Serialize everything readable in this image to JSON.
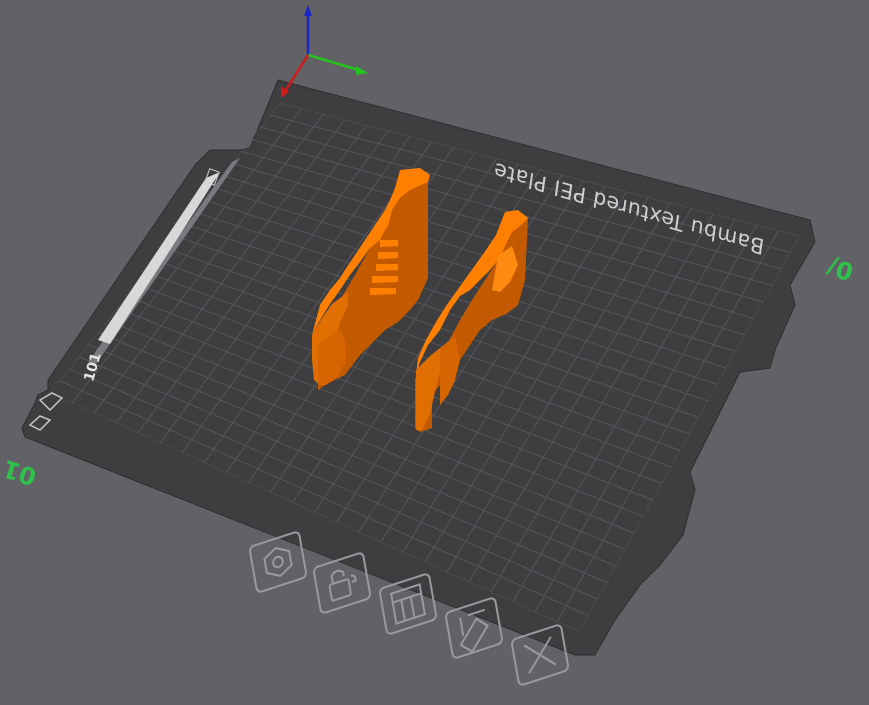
{
  "viewport": {
    "plate_label": "Bambu Textured PEI Plate",
    "plate_number_left": "01",
    "plate_number_right": "0/",
    "side_strip_number": "101",
    "side_strip_text": "----~~~~ ----"
  },
  "colors": {
    "background": "#626266",
    "plate_fill": "#3e3e41",
    "grid_line": "#56565a",
    "model": "#ff8000",
    "axis_x": "#d11a1a",
    "axis_y": "#25c11f",
    "axis_z": "#1a26c9",
    "plate_number": "#2ec14c"
  },
  "toolbar": {
    "buttons": [
      {
        "name": "arrange-button",
        "icon": "hexagon-nut-icon"
      },
      {
        "name": "lock-button",
        "icon": "lock-icon"
      },
      {
        "name": "orient-button",
        "icon": "layout-icon"
      },
      {
        "name": "auto-settings-button",
        "icon": "pen-ruler-icon"
      },
      {
        "name": "close-plate-button",
        "icon": "close-icon"
      }
    ]
  }
}
